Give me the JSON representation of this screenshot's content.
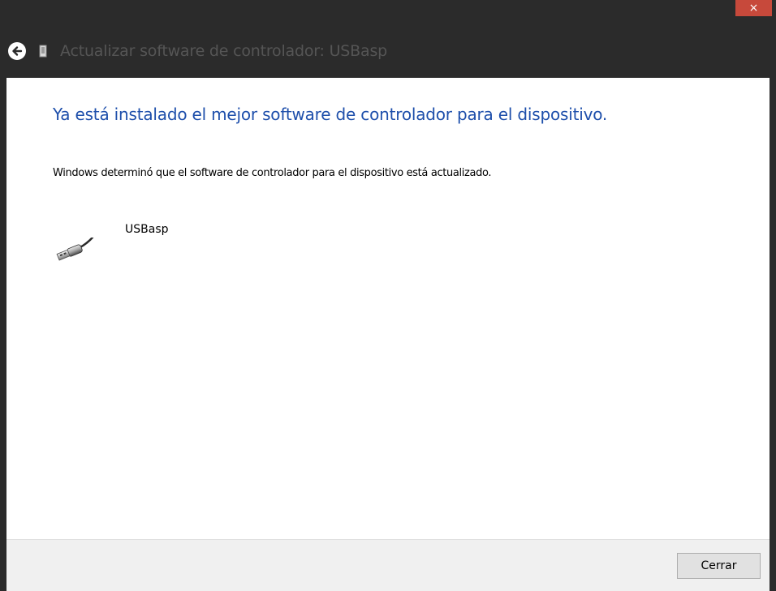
{
  "window": {
    "title": "Actualizar software de controlador: USBasp",
    "close_label": "×"
  },
  "content": {
    "heading": "Ya está instalado el mejor software de controlador para el dispositivo.",
    "description": "Windows determinó que el software de controlador para el dispositivo está actualizado.",
    "device": {
      "name": "USBasp",
      "icon": "usb-plug-icon"
    }
  },
  "footer": {
    "close_button_label": "Cerrar"
  },
  "colors": {
    "chrome_background": "#2b2b2b",
    "close_button": "#c7493b",
    "heading_blue": "#1e4fab",
    "footer_background": "#f0f0f0"
  }
}
